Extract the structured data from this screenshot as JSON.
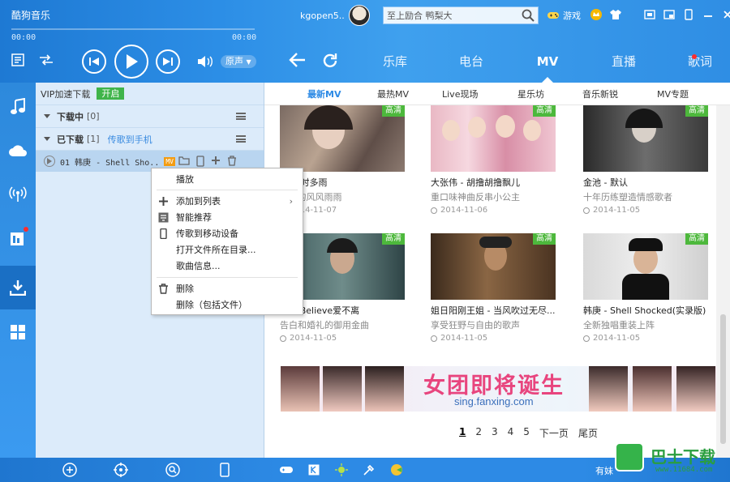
{
  "app": {
    "brand": "酷狗音乐"
  },
  "player": {
    "time_start": "00:00",
    "time_end": "00:00",
    "quality": "原声",
    "progress": 0
  },
  "account": {
    "username": "kgopen5.."
  },
  "search": {
    "value": "至上励合 鸭梨大"
  },
  "top_actions": {
    "games": "游戏"
  },
  "nav": {
    "tabs": [
      {
        "label": "乐库"
      },
      {
        "label": "电台"
      },
      {
        "label": "MV"
      },
      {
        "label": "直播"
      },
      {
        "label": "歌词"
      }
    ],
    "active": "MV"
  },
  "left_panel": {
    "vip_label": "VIP加速下载",
    "vip_button": "开启",
    "downloading": {
      "title": "下载中",
      "count": "[0]"
    },
    "downloaded": {
      "title": "已下载",
      "count": "[1]",
      "link": "传歌到手机"
    },
    "track": {
      "name": "01 韩庚 - Shell Sho..",
      "tag": "MV"
    }
  },
  "context_menu": {
    "items": [
      {
        "label": "播放",
        "icon": ""
      },
      {
        "label": "添加到列表",
        "icon": "plus-icon",
        "submenu": true
      },
      {
        "label": "智能推荐",
        "icon": "recommend-icon"
      },
      {
        "label": "传歌到移动设备",
        "icon": "phone-icon"
      },
      {
        "label": "打开文件所在目录...",
        "icon": ""
      },
      {
        "label": "歌曲信息...",
        "icon": ""
      },
      {
        "label": "删除",
        "icon": "trash-icon"
      },
      {
        "label": "删除（包括文件）",
        "icon": ""
      }
    ]
  },
  "subnav": {
    "tabs": [
      {
        "label": "最新MV"
      },
      {
        "label": "最热MV"
      },
      {
        "label": "Live现场"
      },
      {
        "label": "星乐坊"
      },
      {
        "label": "音乐新锐"
      },
      {
        "label": "MV专题"
      }
    ],
    "active": "最新MV"
  },
  "mv_cards": [
    {
      "title": "...-情时多雨",
      "desc": "...上的风风雨雨",
      "date": "2014-11-07",
      "badge": "高清"
    },
    {
      "title": "大张伟 - 胡撸胡撸飘儿",
      "desc": "重口味神曲反串小公主",
      "date": "2014-11-06",
      "badge": "高清"
    },
    {
      "title": "金池 - 默认",
      "desc": "十年历练塑造情感歌者",
      "date": "2014-11-05",
      "badge": "高清"
    },
    {
      "title": "...- I Believe爱不离",
      "desc": "告白和婚礼的御用金曲",
      "date": "2014-11-05",
      "badge": "高清"
    },
    {
      "title": "姐日阳刚王姐 - 当风吹过无尽...",
      "desc": "享受狂野与自由的歌声",
      "date": "2014-11-05",
      "badge": "高清"
    },
    {
      "title": "韩庚 - Shell Shocked(实录版)",
      "desc": "全新独唱重装上阵",
      "date": "2014-11-05",
      "badge": "高清"
    }
  ],
  "banner": {
    "text": "女团即将诞生",
    "url": "sing.fanxing.com"
  },
  "pager": {
    "pages": [
      "1",
      "2",
      "3",
      "4",
      "5"
    ],
    "next": "下一页",
    "last": "尾页",
    "current": "1"
  },
  "status": {
    "text": "有妹"
  },
  "watermark": {
    "name": "巴士下载",
    "url": "www.11684.com"
  },
  "colors": {
    "accent": "#2d8ae5",
    "hd_badge": "#4db83c",
    "banner_text": "#e8457e"
  }
}
